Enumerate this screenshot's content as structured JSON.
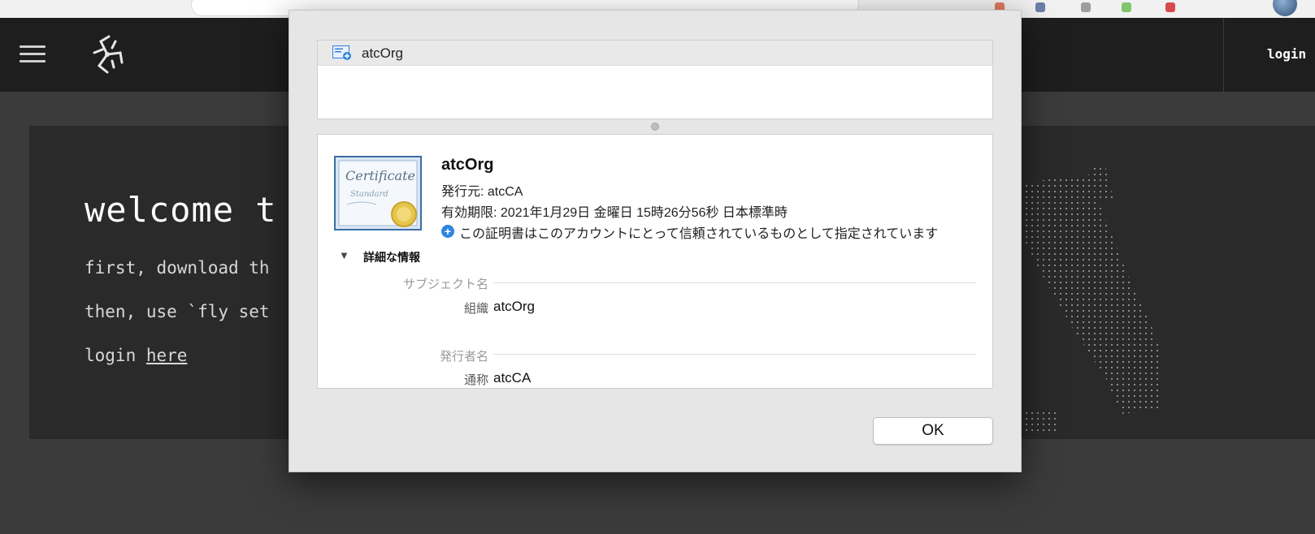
{
  "topbar": {
    "login_label": "login"
  },
  "welcome": {
    "title": "welcome t",
    "line1": "first, download th",
    "line2": "then, use `fly set",
    "line3_prefix": "login ",
    "line3_link": "here"
  },
  "dialog": {
    "list_item": "atcOrg",
    "cert": {
      "name": "atcOrg",
      "issuer_line": "発行元: atcCA",
      "expiry_line": "有効期限: 2021年1月29日 金曜日 15時26分56秒 日本標準時",
      "trust_line": "この証明書はこのアカウントにとって信頼されているものとして指定されています",
      "trust_icon_glyph": "+"
    },
    "details_toggle": "詳細な情報",
    "disclosure_glyph": "▼",
    "subject_section": "サブジェクト名",
    "subject_org_key": "組織",
    "subject_org_value": "atcOrg",
    "issuer_section": "発行者名",
    "issuer_cn_key": "通称",
    "issuer_cn_value": "atcCA",
    "ok_label": "OK"
  },
  "cert_image_text": {
    "line1": "Certificate",
    "line2": "Standard"
  },
  "colors": {
    "topbar": "#1e1e1e",
    "background": "#3b3b3b",
    "card": "#2a2a2a",
    "dialog": "#e6e6e6",
    "trust_blue": "#2d86e0"
  },
  "icons": [
    "hamburger-icon",
    "concourse-logo-icon",
    "certificate-icon",
    "trust-info-icon",
    "disclosure-triangle-icon"
  ]
}
